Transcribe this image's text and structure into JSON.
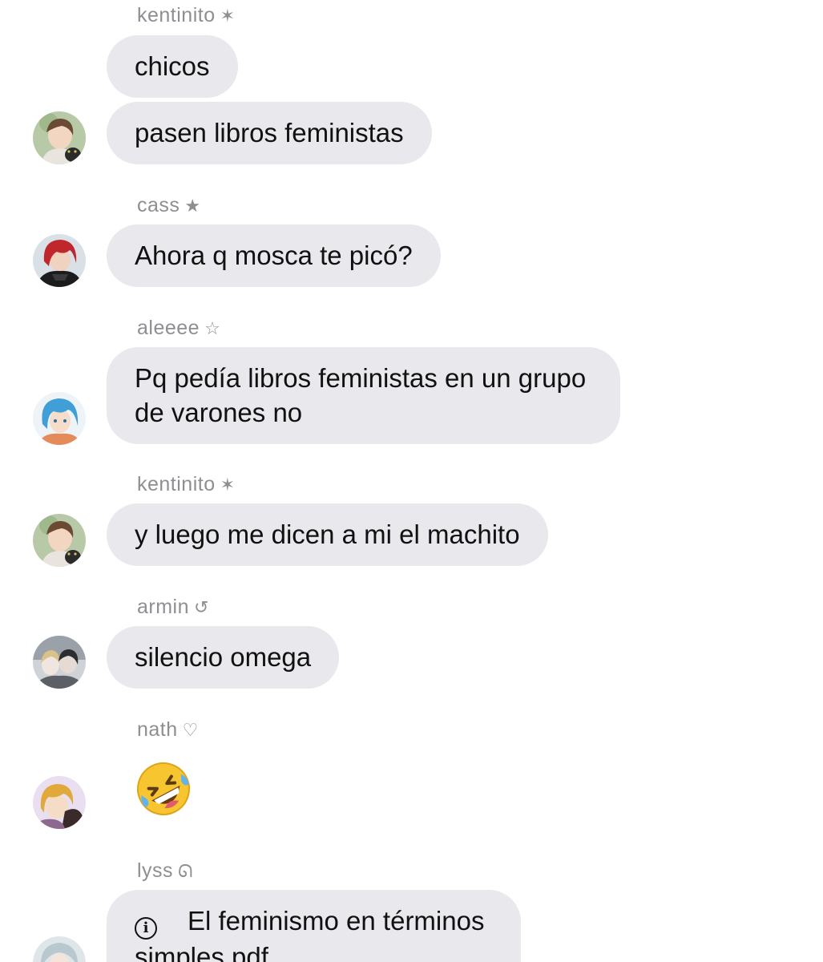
{
  "messages": [
    {
      "author": "kentinito",
      "author_symbol": "✶",
      "lines": [
        "chicos",
        "pasen libros feministas"
      ]
    },
    {
      "author": "cass",
      "author_symbol": "★",
      "lines": [
        "Ahora q mosca te picó?"
      ]
    },
    {
      "author": "aleeee",
      "author_symbol": "☆",
      "lines": [
        "Pq pedía libros feministas en un grupo de varones no"
      ]
    },
    {
      "author": "kentinito",
      "author_symbol": "✶",
      "lines": [
        "y luego me dicen a mi el machito"
      ]
    },
    {
      "author": "armin",
      "author_symbol": "↺",
      "lines": [
        "silencio omega"
      ]
    },
    {
      "author": "nath",
      "author_symbol": "♡",
      "emoji": "rolling-on-the-floor-laughing"
    },
    {
      "author": "lyss",
      "author_symbol": "ᘏ",
      "attachment": {
        "icon": "info-icon",
        "title": "El feminismo en términos simples.pdf"
      }
    }
  ]
}
